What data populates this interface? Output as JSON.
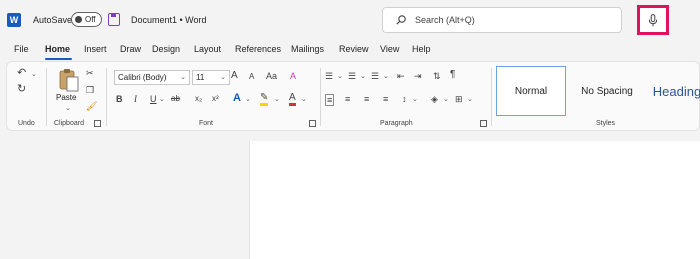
{
  "titlebar": {
    "app_icon": "W",
    "autosave_label": "AutoSave",
    "autosave_state": "Off",
    "document_title": "Document1  •  Word",
    "search_placeholder": "Search (Alt+Q)",
    "mic_icon": "microphone-icon",
    "highlight_color": "#e0115f"
  },
  "tabs": [
    {
      "label": "File"
    },
    {
      "label": "Home",
      "active": true
    },
    {
      "label": "Insert"
    },
    {
      "label": "Draw"
    },
    {
      "label": "Design"
    },
    {
      "label": "Layout"
    },
    {
      "label": "References"
    },
    {
      "label": "Mailings"
    },
    {
      "label": "Review"
    },
    {
      "label": "View"
    },
    {
      "label": "Help"
    }
  ],
  "ribbon": {
    "groups": {
      "undo": "Undo",
      "clipboard": "Clipboard",
      "font": "Font",
      "paragraph": "Paragraph",
      "styles": "Styles"
    },
    "paste_label": "Paste",
    "font_name": "Calibri (Body)",
    "font_size": "11",
    "bold": "B",
    "italic": "I",
    "underline": "U",
    "strikethrough": "ab",
    "subscript": "x₂",
    "superscript": "x²",
    "grow_font": "A",
    "shrink_font": "A",
    "change_case": "Aa",
    "clear_format": "A",
    "text_effects": "A",
    "font_color": "A",
    "pilcrow": "¶",
    "styles": {
      "normal": "Normal",
      "no_spacing": "No Spacing",
      "heading": "Heading"
    }
  },
  "colors": {
    "accent": "#185abd",
    "highlight": "#ffd400",
    "font_red": "#d13438"
  }
}
